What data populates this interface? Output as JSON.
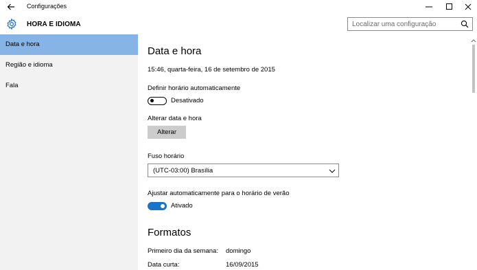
{
  "window": {
    "title": "Configurações"
  },
  "header": {
    "title": "HORA E IDIOMA"
  },
  "search": {
    "placeholder": "Localizar uma configuração"
  },
  "sidebar": {
    "items": [
      {
        "label": "Data e hora",
        "active": true
      },
      {
        "label": "Região e idioma",
        "active": false
      },
      {
        "label": "Fala",
        "active": false
      }
    ]
  },
  "main": {
    "section_title": "Data e hora",
    "current_datetime": "15:46, quarta-feira, 16 de setembro de 2015",
    "auto_time": {
      "label": "Definir horário automaticamente",
      "state_label": "Desativado",
      "on": false
    },
    "change_datetime": {
      "label": "Alterar data e hora",
      "button_label": "Alterar"
    },
    "timezone": {
      "label": "Fuso horário",
      "value": "(UTC-03:00) Brasília"
    },
    "dst": {
      "label": "Ajustar automaticamente para o horário de verão",
      "state_label": "Ativado",
      "on": true
    },
    "formats": {
      "title": "Formatos",
      "rows": [
        {
          "label": "Primeiro dia da semana:",
          "value": "domingo"
        },
        {
          "label": "Data curta:",
          "value": "16/09/2015"
        }
      ]
    }
  },
  "colors": {
    "accent": "#1a73c9",
    "nav_active": "#87b4e6",
    "sidebar_bg": "#f2f2f2"
  },
  "icons": {
    "back": "back-arrow-icon",
    "settings": "gear-icon",
    "search": "search-icon"
  }
}
